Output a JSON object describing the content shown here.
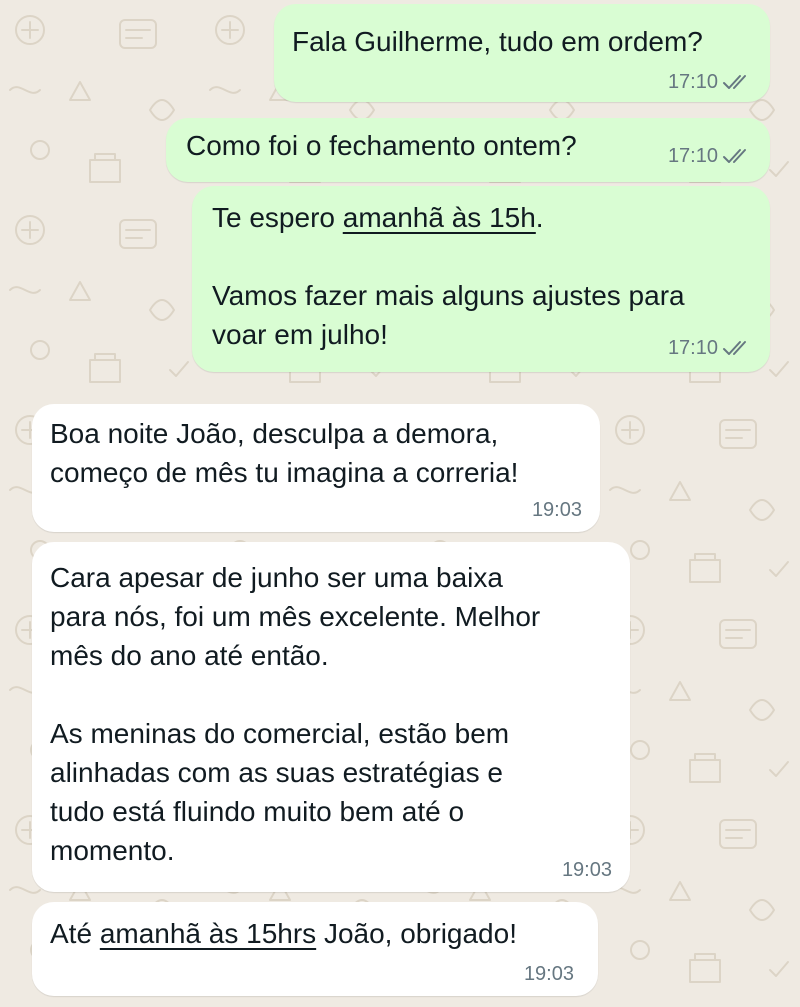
{
  "theme": {
    "outgoing_bubble": "#d9fdd3",
    "incoming_bubble": "#ffffff",
    "background": "#efeae2",
    "meta_text": "#667781"
  },
  "messages": [
    {
      "direction": "outgoing",
      "status_icon": "double-check-icon",
      "time": "17:10",
      "lines": [
        [
          "Fala Guilherme, tudo em ordem?"
        ]
      ]
    },
    {
      "direction": "outgoing",
      "status_icon": "double-check-icon",
      "time": "17:10",
      "lines": [
        [
          "Como foi o fechamento ontem?"
        ]
      ]
    },
    {
      "direction": "outgoing",
      "status_icon": "double-check-icon",
      "time": "17:10",
      "lines": [
        [
          "Te espero ",
          "amanhã às 15h",
          "."
        ],
        [
          ""
        ],
        [
          "Vamos fazer mais alguns ajustes para"
        ],
        [
          "voar em julho!"
        ]
      ]
    },
    {
      "direction": "incoming",
      "time": "19:03",
      "lines": [
        [
          "Boa noite João, desculpa a demora,"
        ],
        [
          "começo de mês tu imagina a correria!"
        ]
      ]
    },
    {
      "direction": "incoming",
      "time": "19:03",
      "lines": [
        [
          "Cara apesar de junho ser uma baixa"
        ],
        [
          "para nós, foi um mês excelente. Melhor"
        ],
        [
          "mês do ano até então."
        ],
        [
          ""
        ],
        [
          "As meninas do comercial, estão bem"
        ],
        [
          "alinhadas com as suas estratégias e"
        ],
        [
          "tudo está fluindo muito bem até o"
        ],
        [
          "momento."
        ]
      ]
    },
    {
      "direction": "incoming",
      "time": "19:03",
      "lines": [
        [
          "Até ",
          "amanhã às 15hrs",
          " João, obrigado!"
        ]
      ]
    }
  ]
}
